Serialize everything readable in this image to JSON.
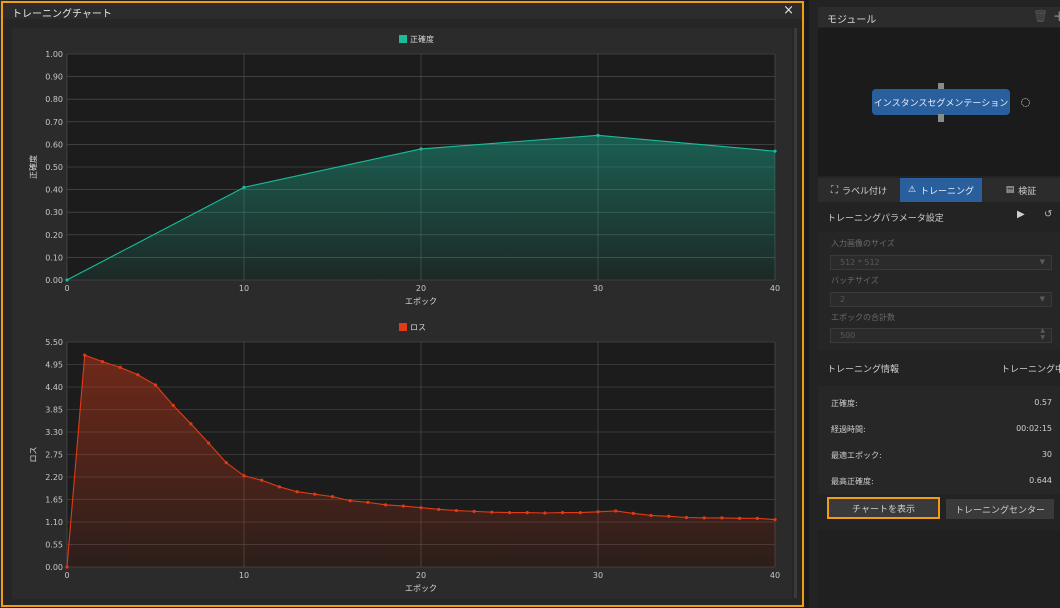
{
  "modal": {
    "title": "トレーニングチャート",
    "close": "×"
  },
  "charts": [
    {
      "type": "area-line",
      "legend": "正確度",
      "color": "#1abc9c",
      "ylabel": "正確度",
      "xlabel": "エポック",
      "xlim": [
        0,
        40
      ],
      "ylim": [
        0,
        1
      ],
      "x_ticks": [
        "0",
        "10",
        "20",
        "30",
        "40"
      ],
      "y_ticks": [
        "0.00",
        "0.10",
        "0.20",
        "0.30",
        "0.40",
        "0.50",
        "0.60",
        "0.70",
        "0.80",
        "0.90",
        "1.00"
      ]
    },
    {
      "type": "area-line",
      "legend": "ロス",
      "color": "#e23a14",
      "ylabel": "ロス",
      "xlabel": "エポック",
      "xlim": [
        0,
        40
      ],
      "ylim": [
        0,
        5.5
      ],
      "x_ticks": [
        "0",
        "10",
        "20",
        "30",
        "40"
      ],
      "y_ticks": [
        "0.00",
        "0.55",
        "1.10",
        "1.65",
        "2.20",
        "2.75",
        "3.30",
        "3.85",
        "4.40",
        "4.95",
        "5.50"
      ]
    }
  ],
  "chart_data": [
    {
      "type": "line",
      "title": "正確度",
      "xlabel": "エポック",
      "ylabel": "正確度",
      "x": [
        0,
        10,
        20,
        30,
        40
      ],
      "series": [
        {
          "name": "正確度",
          "values": [
            0.0,
            0.41,
            0.58,
            0.64,
            0.57
          ]
        }
      ],
      "xlim": [
        0,
        40
      ],
      "ylim": [
        0,
        1.0
      ],
      "grid": true,
      "legend": "top-center"
    },
    {
      "type": "line",
      "title": "ロス",
      "xlabel": "エポック",
      "ylabel": "ロス",
      "x": [
        0,
        1,
        2,
        3,
        4,
        5,
        6,
        7,
        8,
        9,
        10,
        11,
        12,
        13,
        14,
        15,
        16,
        17,
        18,
        19,
        20,
        21,
        22,
        23,
        24,
        25,
        26,
        27,
        28,
        29,
        30,
        31,
        32,
        33,
        34,
        35,
        36,
        37,
        38,
        39,
        40
      ],
      "series": [
        {
          "name": "ロス",
          "values": [
            0.0,
            5.18,
            5.02,
            4.88,
            4.7,
            4.45,
            3.95,
            3.5,
            3.03,
            2.55,
            2.23,
            2.12,
            1.96,
            1.84,
            1.78,
            1.72,
            1.62,
            1.58,
            1.52,
            1.49,
            1.45,
            1.41,
            1.38,
            1.36,
            1.34,
            1.33,
            1.33,
            1.32,
            1.33,
            1.33,
            1.35,
            1.37,
            1.31,
            1.26,
            1.24,
            1.21,
            1.2,
            1.2,
            1.19,
            1.19,
            1.16
          ]
        }
      ],
      "xlim": [
        0,
        40
      ],
      "ylim": [
        0,
        5.5
      ],
      "grid": true,
      "legend": "top-center"
    }
  ],
  "right_panel": {
    "module_header": "モジュール",
    "node_label": "インスタンスセグメンテーション",
    "tabs": [
      {
        "label": "ラベル付け",
        "icon": "label-icon"
      },
      {
        "label": "トレーニング",
        "icon": "training-icon"
      },
      {
        "label": "検証",
        "icon": "validate-icon"
      }
    ],
    "params_header": "トレーニングパラメータ設定",
    "fields": [
      {
        "label": "入力画像のサイズ",
        "value": "512 * 512"
      },
      {
        "label": "バッチサイズ",
        "value": "2"
      },
      {
        "label": "エポックの合計数",
        "value": "500"
      }
    ],
    "info_header": "トレーニング情報",
    "info_status": "トレーニング中",
    "info_rows": [
      {
        "label": "正確度:",
        "value": "0.57"
      },
      {
        "label": "経過時間:",
        "value": "00:02:15"
      },
      {
        "label": "最適エポック:",
        "value": "30"
      },
      {
        "label": "最高正確度:",
        "value": "0.644"
      }
    ],
    "buttons": {
      "show_chart": "チャートを表示",
      "training_center": "トレーニングセンター"
    }
  }
}
